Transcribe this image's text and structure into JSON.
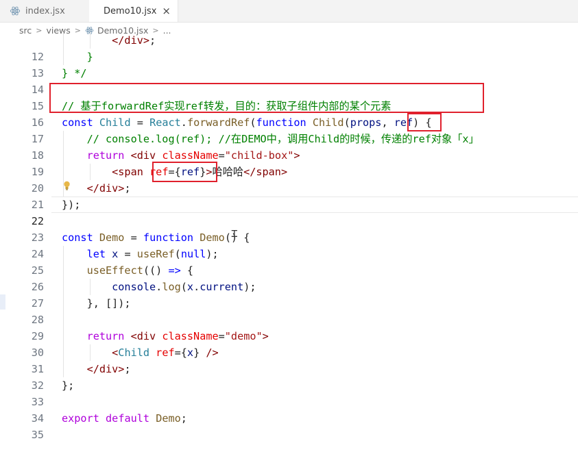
{
  "tabs": [
    {
      "label": "index.jsx",
      "icon": "react-icon",
      "active": false
    },
    {
      "label": "Demo10.jsx",
      "icon": "react-icon",
      "active": true,
      "close": "×"
    }
  ],
  "breadcrumb": [
    "src",
    "views",
    "Demo10.jsx",
    "..."
  ],
  "editor": {
    "current_line": 22,
    "lines": [
      {
        "n": "12",
        "code": "        </div>;"
      },
      {
        "n": "13",
        "code": "    }"
      },
      {
        "n": "14",
        "code": "} */"
      },
      {
        "n": "15",
        "code": ""
      },
      {
        "n": "16",
        "code": "// 基于forwardRef实现ref转发，目的：获取子组件内部的某个元素"
      },
      {
        "n": "17",
        "code": "const Child = React.forwardRef(function Child(props, ref) {"
      },
      {
        "n": "18",
        "code": "    // console.log(ref); //在DEMO中，调用Child的时候，传递的ref对象「x」"
      },
      {
        "n": "19",
        "code": "    return <div className=\"child-box\">"
      },
      {
        "n": "20",
        "code": "        <span ref={ref}>哈哈哈</span>"
      },
      {
        "n": "21",
        "code": "    </div>;"
      },
      {
        "n": "22",
        "code": "});"
      },
      {
        "n": "23",
        "code": ""
      },
      {
        "n": "24",
        "code": "const Demo = function Demo() {"
      },
      {
        "n": "25",
        "code": "    let x = useRef(null);"
      },
      {
        "n": "26",
        "code": "    useEffect(() => {"
      },
      {
        "n": "27",
        "code": "        console.log(x.current);"
      },
      {
        "n": "28",
        "code": "    }, []);"
      },
      {
        "n": "29",
        "code": ""
      },
      {
        "n": "30",
        "code": "    return <div className=\"demo\">"
      },
      {
        "n": "31",
        "code": "        <Child ref={x} />"
      },
      {
        "n": "32",
        "code": "    </div>;"
      },
      {
        "n": "33",
        "code": "};"
      },
      {
        "n": "34",
        "code": ""
      },
      {
        "n": "35",
        "code": "export default Demo;"
      }
    ]
  },
  "colors": {
    "annotation_box": "#e0202c",
    "keyword": "#0000ff",
    "comment": "#008000",
    "string": "#a31515"
  },
  "icons": [
    "react-icon",
    "close-icon",
    "chevron-right-icon",
    "lightbulb-icon",
    "text-cursor-icon"
  ]
}
